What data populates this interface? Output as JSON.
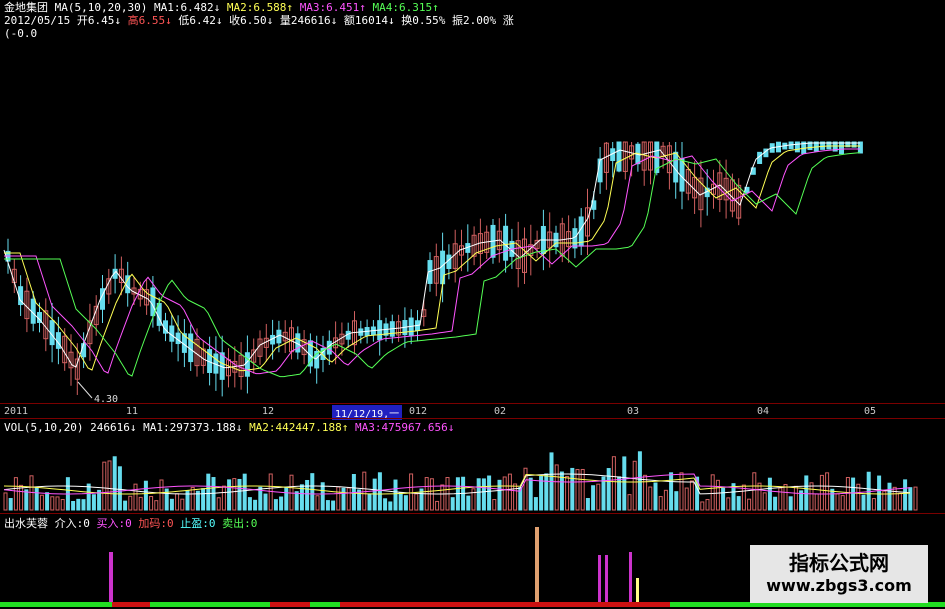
{
  "info": {
    "stock_name": "金地集团",
    "ma_label": "MA(5,10,20,30)",
    "ma1": "MA1:6.482↓",
    "ma2": "MA2:6.588↑",
    "ma3": "MA3:6.451↑",
    "ma4": "MA4:6.315↑",
    "date": "2012/05/15",
    "open": "开6.45↓",
    "high": "高6.55↓",
    "low": "低6.42↓",
    "close": "收6.50↓",
    "volume": "量246616↓",
    "amount": "额16014↓",
    "turnover": "换0.55%",
    "amplitude": "振2.00%",
    "change": "涨(-0.0"
  },
  "price_axis": {
    "low_marker": "4.30",
    "dates": [
      "2011",
      "11",
      "12",
      "012",
      "02",
      "03",
      "04",
      "05"
    ],
    "cursor_date": "11/12/19,一"
  },
  "vol": {
    "label": "VOL(5,10,20)",
    "value": "246616↓",
    "ma1": "MA1:297373.188↓",
    "ma2": "MA2:442447.188↑",
    "ma3": "MA3:475967.656↓"
  },
  "indicator": {
    "name": "出水芙蓉",
    "enter": "介入:0",
    "buy": "买入:0",
    "add": "加码:0",
    "stop": "止盈:0",
    "sell": "卖出:0"
  },
  "watermark": {
    "title": "指标公式网",
    "url": "www.zbgs3.com"
  },
  "colors": {
    "up": "#d06060",
    "down": "#66ddee",
    "ma1": "#ffffff",
    "ma2": "#ffff55",
    "ma3": "#ff55ff",
    "ma4": "#55ff55"
  }
}
